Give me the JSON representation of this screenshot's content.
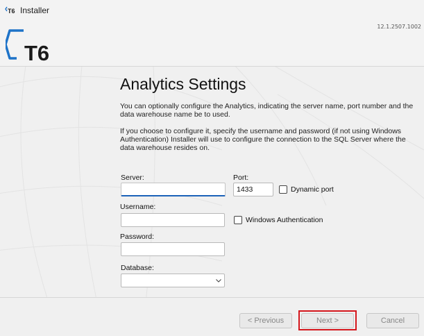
{
  "window": {
    "title": "Installer",
    "version": "12.1.2507.1002",
    "logo_text": "T6"
  },
  "page": {
    "title": "Analytics Settings",
    "intro": "You can optionally configure the Analytics, indicating the server name, port number and the data warehouse name be to used.",
    "instructions": "If you choose to configure it, specify the username and password (if not using Windows Authentication) Installer will use to configure the connection to the SQL Server where the data warehouse resides on."
  },
  "form": {
    "server_label": "Server:",
    "server_value": "",
    "port_label": "Port:",
    "port_value": "1433",
    "dynamic_port_label": "Dynamic port",
    "dynamic_port_checked": false,
    "username_label": "Username:",
    "username_value": "",
    "windows_auth_label": "Windows Authentication",
    "windows_auth_checked": false,
    "password_label": "Password:",
    "password_value": "",
    "database_label": "Database:",
    "database_value": ""
  },
  "footer": {
    "previous_label": "< Previous",
    "next_label": "Next >",
    "cancel_label": "Cancel"
  },
  "colors": {
    "focus_accent": "#1b62b8",
    "highlight": "#d4161c",
    "logo_blue": "#1e73c8"
  }
}
